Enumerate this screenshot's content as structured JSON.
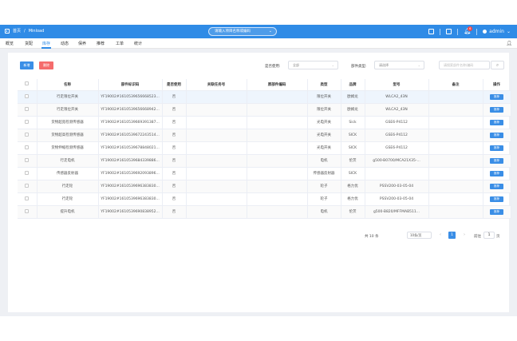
{
  "topbar": {
    "breadcrumb_home": "首页",
    "breadcrumb_sep": "/",
    "breadcrumb_current": "Minload",
    "search_placeholder": "请输入项目名称或编码",
    "user_name": "admin",
    "notification_count": "6",
    "brand_color": "#2f8be6"
  },
  "nav": {
    "tabs": [
      "概览",
      "货配",
      "库存",
      "动态",
      "保养",
      "推荐",
      "工单",
      "统计"
    ],
    "active_index": 2
  },
  "toolbar": {
    "add_label": "新增",
    "delete_label": "删除",
    "filter_used_label": "是否使用:",
    "filter_used_value": "全部",
    "filter_type_label": "部件类型:",
    "filter_type_placeholder": "请选择",
    "search_placeholder": "请搜索部件名称/编码"
  },
  "table": {
    "columns": [
      "",
      "名称",
      "部件标识码",
      "是否使用",
      "关联任务号",
      "原部件编码",
      "类型",
      "品牌",
      "型号",
      "备注",
      "操作"
    ],
    "rows": [
      {
        "name": "行走限位开关",
        "code": "YF19002#1610539656668523...",
        "used": "否",
        "task": "",
        "orig": "",
        "type": "限位开关",
        "brand": "欧姆龙",
        "model": "WLCA2_43N",
        "note": "",
        "action": "推荐"
      },
      {
        "name": "行走限位开关",
        "code": "YF19002#1610539656668942...",
        "used": "否",
        "task": "",
        "orig": "",
        "type": "限位开关",
        "brand": "欧姆龙",
        "model": "WLCA2_43N",
        "note": "",
        "action": "推荐"
      },
      {
        "name": "货物超宽检测传感器",
        "code": "YF19002#1610539669391387...",
        "used": "否",
        "task": "",
        "orig": "",
        "type": "光电开关",
        "brand": "Sick",
        "model": "GSE6-P4112",
        "note": "",
        "action": "推荐"
      },
      {
        "name": "货物超高检测传感器",
        "code": "YF19002#1610539672243514...",
        "used": "否",
        "task": "",
        "orig": "",
        "type": "光电开关",
        "brand": "SICK",
        "model": "GSE6-P4112",
        "note": "",
        "action": "推荐"
      },
      {
        "name": "货物伸缩检测传感器",
        "code": "YF19002#1610539678848021...",
        "used": "否",
        "task": "",
        "orig": "",
        "type": "光电开关",
        "brand": "SICK",
        "model": "GSE6-P4112",
        "note": "",
        "action": "推荐"
      },
      {
        "name": "行走电机",
        "code": "YF19002#1610539684339886...",
        "used": "否",
        "task": "",
        "orig": "",
        "type": "电机",
        "brand": "伦茨",
        "model": "g500-B0700/MCA21X35-...",
        "note": "",
        "action": "推荐"
      },
      {
        "name": "传感器反射器",
        "code": "YF19002#1610539692093896...",
        "used": "否",
        "task": "",
        "orig": "",
        "type": "传感器反射器",
        "brand": "SICK",
        "model": "",
        "note": "",
        "action": "推荐"
      },
      {
        "name": "行走轮",
        "code": "YF19002#1610539696383830...",
        "used": "否",
        "task": "",
        "orig": "",
        "type": "轮子",
        "brand": "格力优",
        "model": "PSSV200-03-05-04",
        "note": "",
        "action": "推荐"
      },
      {
        "name": "行走轮",
        "code": "YF19002#1610539696383830...",
        "used": "否",
        "task": "",
        "orig": "",
        "type": "轮子",
        "brand": "格力优",
        "model": "PSSV200-03-05-04",
        "note": "",
        "action": "推荐"
      },
      {
        "name": "提升电机",
        "code": "YF19002#1610539690838952...",
        "used": "否",
        "task": "",
        "orig": "",
        "type": "电机",
        "brand": "伦茨",
        "model": "g500-B820/MFFMAB511...",
        "note": "",
        "action": "推荐"
      }
    ]
  },
  "pagination": {
    "total_text": "共 10 条",
    "page_size": "10条/页",
    "prev": "‹",
    "current": "1",
    "next": "›",
    "goto_label": "前往",
    "goto_value": "1",
    "page_suffix": "页"
  }
}
